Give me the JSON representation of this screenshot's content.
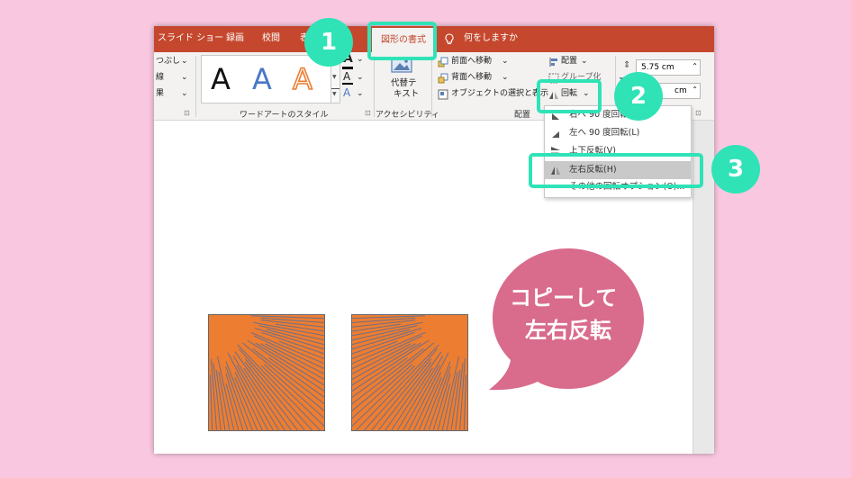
{
  "tabs": {
    "slideshow": "スライド ショー",
    "record": "録画",
    "review": "校閲",
    "view_partial": "表",
    "active": "図形の書式",
    "tell_me": "何をしますか"
  },
  "ribbon": {
    "fill_partial": "つぶし",
    "line_partial": "線",
    "effect_partial": "果",
    "wordart_samples": [
      "A",
      "A",
      "A"
    ],
    "wordart_group": "ワードアートのスタイル",
    "alt_text_line1": "代替テ",
    "alt_text_line2": "キスト",
    "accessibility_group": "アクセシビリティ",
    "bring_forward": "前面へ移動",
    "send_backward": "背面へ移動",
    "selection_pane": "オブジェクトの選択と表示",
    "align": "配置",
    "group": "グループ化",
    "rotate": "回転",
    "arrange_group": "配置",
    "height_value": "5.75 cm",
    "width_value": "cm"
  },
  "rotate_menu": {
    "items": [
      "右へ 90 度回転(R)",
      "左へ 90 度回転(L)",
      "上下反転(V)",
      "左右反転(H)",
      "その他の回転オプション(O)..."
    ]
  },
  "callouts": {
    "step1": "1",
    "step2": "2",
    "step3": "3",
    "bubble_line1": "コピーして",
    "bubble_line2": "左右反転"
  },
  "colors": {
    "tabbar": "#c5482e",
    "highlight": "#2fe3b7",
    "bubble": "#d96b8c",
    "shape_fill": "#ed7d31",
    "shape_lines": "#6b6f8a",
    "background": "#f9c8e0"
  },
  "icons": [
    "lightbulb-icon",
    "bring-forward-icon",
    "send-backward-icon",
    "selection-pane-icon",
    "align-icon",
    "group-icon",
    "rotate-icon",
    "alt-text-icon",
    "rotate-right-icon",
    "rotate-left-icon",
    "flip-vertical-icon",
    "flip-horizontal-icon"
  ]
}
